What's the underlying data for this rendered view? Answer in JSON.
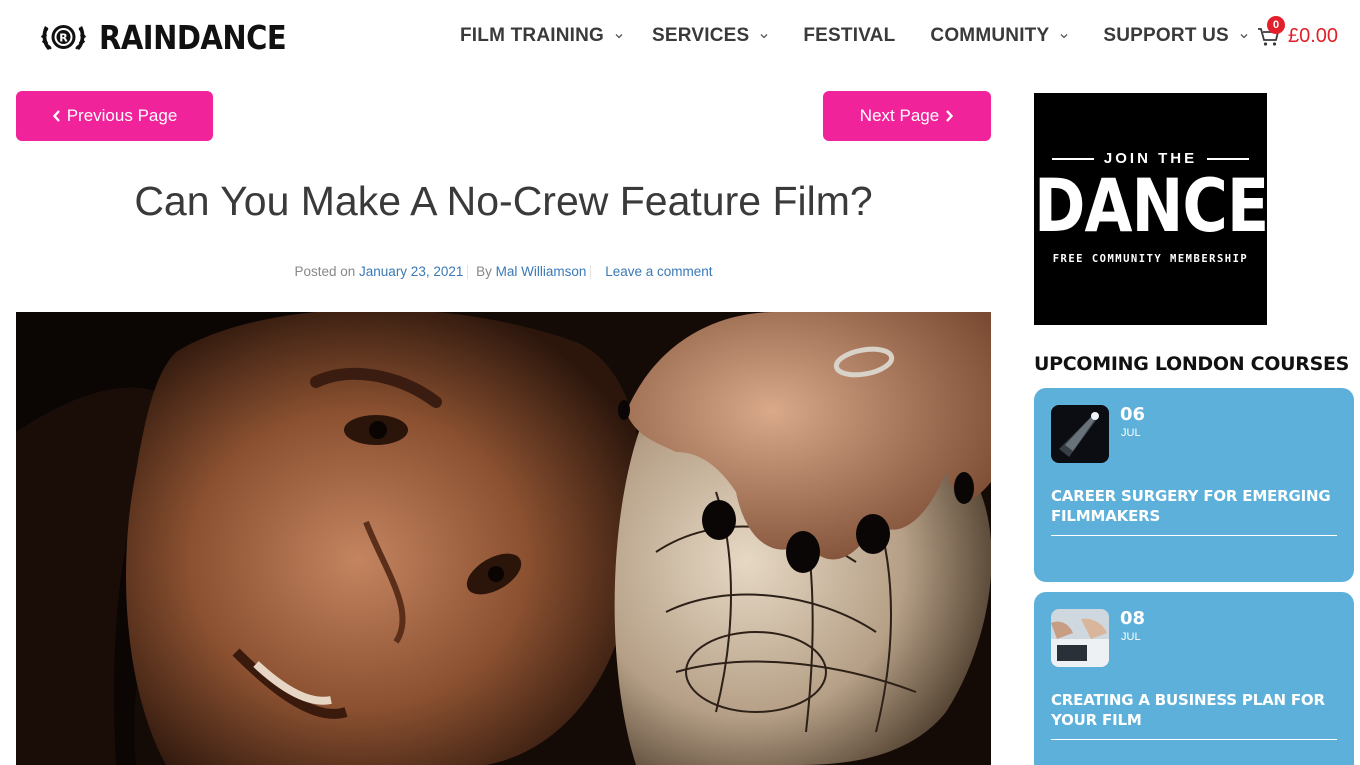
{
  "brand": {
    "name": "RAINDANCE"
  },
  "nav": {
    "items": [
      {
        "label": "FILM TRAINING",
        "has_dropdown": true
      },
      {
        "label": "SERVICES",
        "has_dropdown": true
      },
      {
        "label": "FESTIVAL",
        "has_dropdown": false
      },
      {
        "label": "COMMUNITY",
        "has_dropdown": true
      },
      {
        "label": "SUPPORT US",
        "has_dropdown": true
      }
    ],
    "cart": {
      "count": "0",
      "amount": "£0.00"
    }
  },
  "pager": {
    "prev_label": "Previous Page",
    "next_label": "Next Page"
  },
  "article": {
    "title": "Can You Make A No-Crew Feature Film?",
    "posted_prefix": "Posted on",
    "date": "January 23, 2021",
    "by_prefix": "By",
    "author": "Mal Williamson",
    "comment_link": "Leave a comment"
  },
  "sidebar": {
    "banner": {
      "top": "JOIN THE",
      "main": "DANCE",
      "sub": "FREE COMMUNITY MEMBERSHIP"
    },
    "courses_title": "UPCOMING LONDON COURSES",
    "courses": [
      {
        "day": "06",
        "month": "JUL",
        "name": "Career Surgery For Emerging Filmmakers"
      },
      {
        "day": "08",
        "month": "JUL",
        "name": "Creating A Business Plan For Your Film"
      }
    ]
  },
  "colors": {
    "accent_pink": "#f0239b",
    "card_blue": "#5db0d9",
    "cart_red": "#e2202b",
    "link_blue": "#3a79b6"
  }
}
